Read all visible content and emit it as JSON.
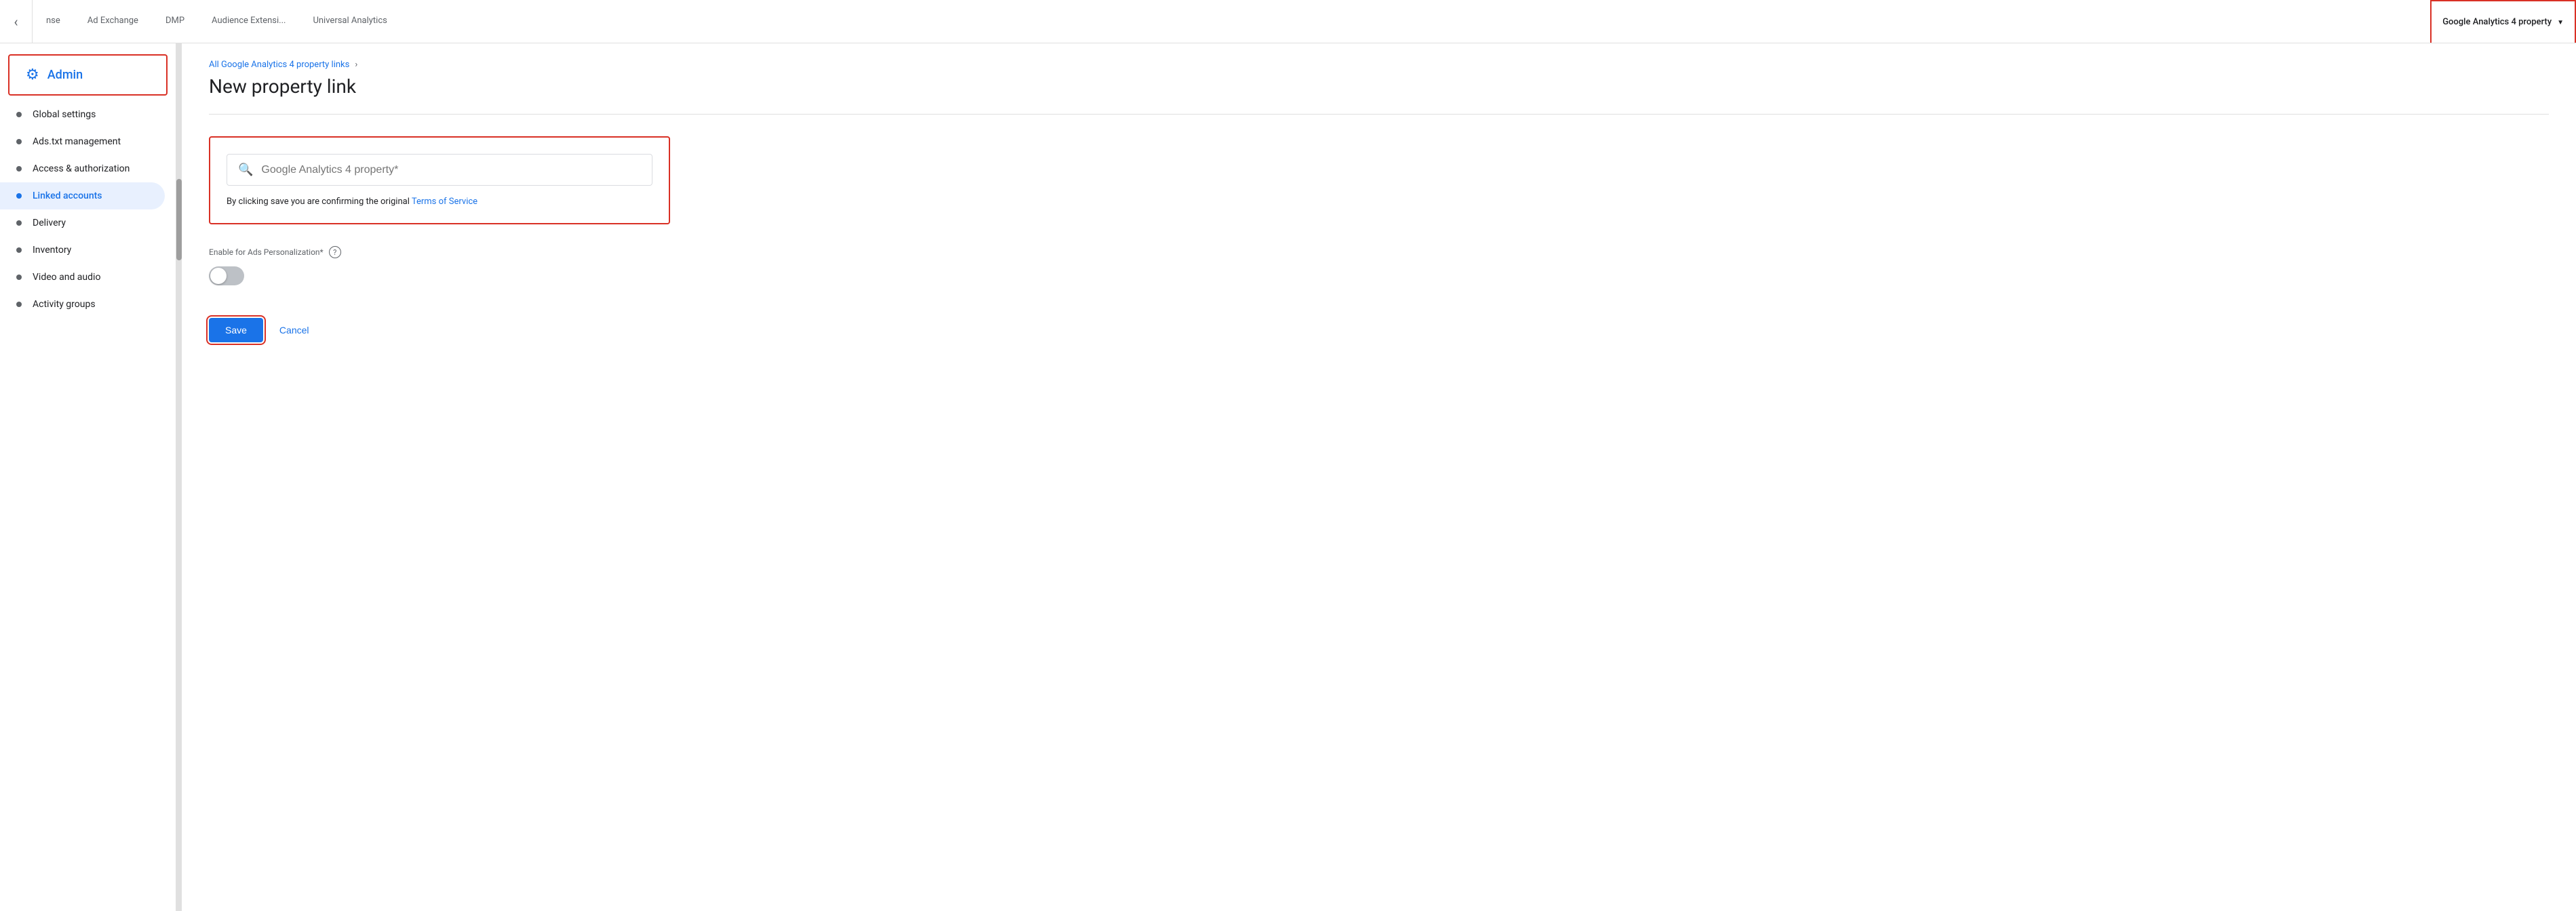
{
  "topNav": {
    "backButton": "‹",
    "tabs": [
      {
        "label": "nse",
        "active": false
      },
      {
        "label": "Ad Exchange",
        "active": false
      },
      {
        "label": "DMP",
        "active": false
      },
      {
        "label": "Audience Extensi...",
        "active": false
      },
      {
        "label": "Universal Analytics",
        "active": false
      }
    ],
    "activeDropdown": {
      "label": "Google Analytics 4 property"
    }
  },
  "sidebar": {
    "header": {
      "icon": "⚙",
      "label": "Admin"
    },
    "items": [
      {
        "label": "Global settings",
        "active": false
      },
      {
        "label": "Ads.txt management",
        "active": false
      },
      {
        "label": "Access & authorization",
        "active": false
      },
      {
        "label": "Linked accounts",
        "active": true
      },
      {
        "label": "Delivery",
        "active": false
      },
      {
        "label": "Inventory",
        "active": false
      },
      {
        "label": "Video and audio",
        "active": false
      },
      {
        "label": "Activity groups",
        "active": false
      }
    ]
  },
  "breadcrumb": {
    "link": "All Google Analytics 4 property links",
    "chevron": "›"
  },
  "pageTitle": "New property link",
  "form": {
    "searchPlaceholder": "Google Analytics 4 property*",
    "tosText": "By clicking save you are confirming the original ",
    "tosLinkText": "Terms of Service",
    "adsPersonalizationLabel": "Enable for Ads Personalization*",
    "helpIconLabel": "?"
  },
  "actions": {
    "saveLabel": "Save",
    "cancelLabel": "Cancel"
  }
}
